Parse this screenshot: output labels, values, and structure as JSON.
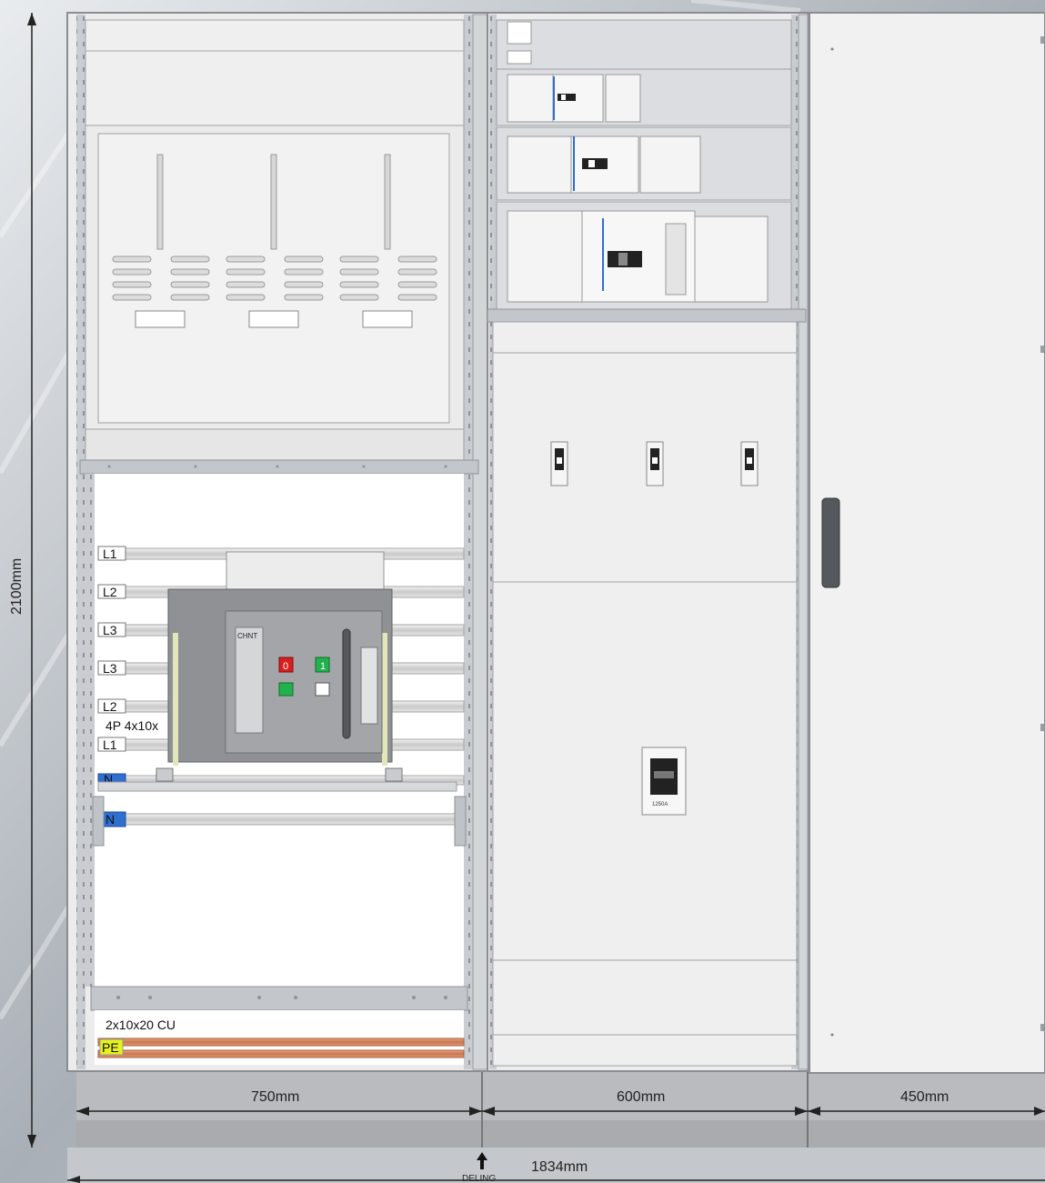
{
  "dimensions": {
    "height": "2100mm",
    "section_widths": [
      "750mm",
      "600mm",
      "450mm"
    ],
    "total_width": "1834mm",
    "split_marker": "DELING"
  },
  "busbars": {
    "phase_tags": [
      "L1",
      "L2",
      "L3",
      "L3",
      "L2",
      "L1",
      "N",
      "N",
      "PE"
    ],
    "main_spec": "4P 4x10x",
    "pe_spec": "2x10x20 CU"
  },
  "breaker": {
    "brand": "CHNT",
    "off_label": "0",
    "on_label": "1"
  },
  "mccb_rating": "1250A",
  "colors": {
    "off_button": "#d81e1e",
    "on_button": "#22b24c",
    "neutral_tag": "#2f6fd0",
    "pe_tag": "#e6f21c",
    "copper": "#d98a62"
  }
}
